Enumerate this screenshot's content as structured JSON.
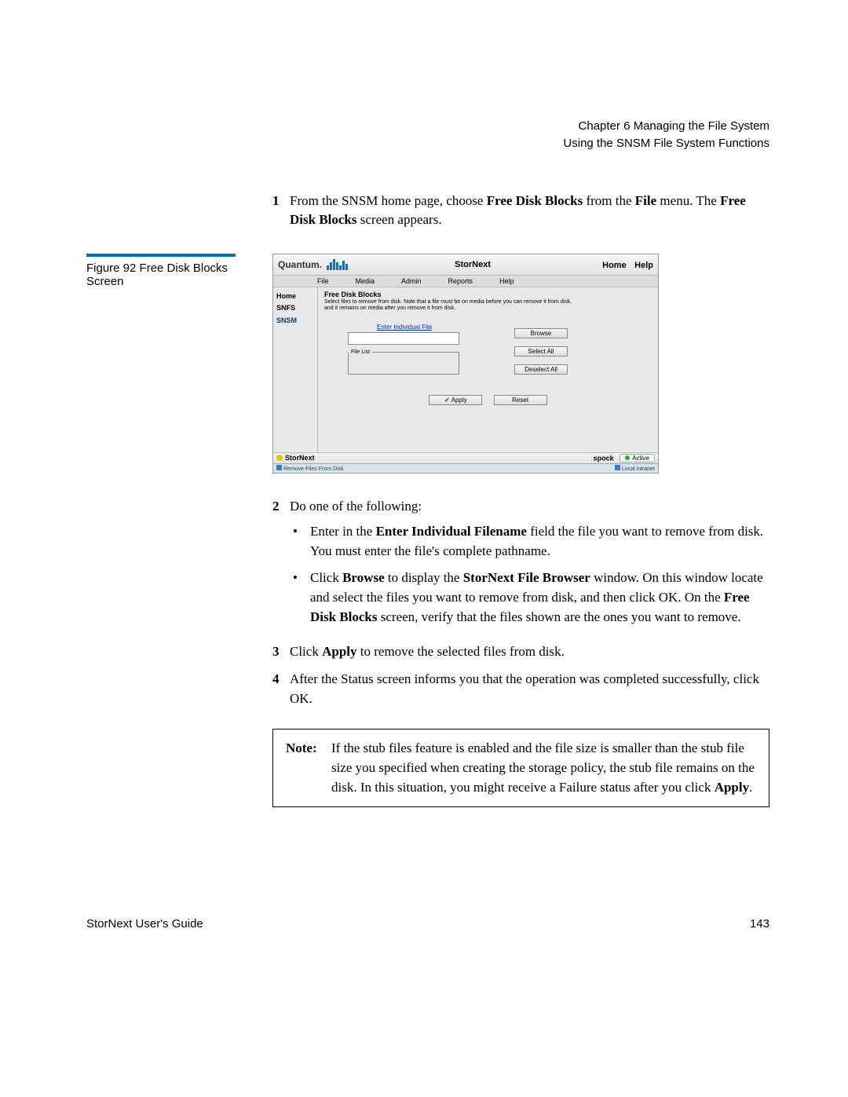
{
  "header": {
    "chapter": "Chapter 6  Managing the File System",
    "section": "Using the SNSM File System Functions"
  },
  "figure_caption": "Figure 92  Free Disk Blocks Screen",
  "step1": {
    "pre": "From the SNSM home page, choose ",
    "b1": "Free Disk Blocks",
    "mid1": " from the ",
    "b2": "File",
    "mid2": " menu. The ",
    "b3": "Free Disk Blocks",
    "post": " screen appears."
  },
  "screenshot": {
    "brand": "Quantum.",
    "app": "StorNext",
    "top_links": {
      "home": "Home",
      "help": "Help"
    },
    "menu": [
      "File",
      "Media",
      "Admin",
      "Reports",
      "Help"
    ],
    "sidebar": [
      "Home",
      "SNFS",
      "SNSM"
    ],
    "panel_title": "Free Disk Blocks",
    "panel_desc": "Select files to remove from disk. Note that a file must be on media before you can remove it from disk, and it remains on media after you remove it from disk.",
    "enter_link": "Enter Individual File",
    "file_list_legend": "File List",
    "buttons": {
      "browse": "Browse",
      "select_all": "Select All",
      "deselect_all": "Deselect All",
      "apply": "Apply",
      "reset": "Reset"
    },
    "foot_app": "StorNext",
    "foot_host": "spock",
    "foot_state": "Active",
    "status_left": "Remove Files From Disk",
    "status_right": "Local intranet"
  },
  "step2_intro": "Do one of the following:",
  "bullet1": {
    "pre": "Enter in the ",
    "b1": "Enter Individual Filename",
    "post": " field the file you want to remove from disk. You must enter the file's complete pathname."
  },
  "bullet2": {
    "pre": "Click ",
    "b1": "Browse",
    "mid1": " to display the ",
    "b2": "StorNext File Browser",
    "mid2": " window. On this window locate and select the files you want to remove from disk, and then click OK. On the ",
    "b3": "Free Disk Blocks",
    "post": " screen, verify that the files shown are the ones you want to remove."
  },
  "step3": {
    "pre": "Click ",
    "b1": "Apply",
    "post": " to remove the selected files from disk."
  },
  "step4": "After the Status screen informs you that the operation was completed successfully, click OK.",
  "note": {
    "label": "Note:",
    "pre": "If the stub files feature is enabled and the file size is smaller than the stub file size you specified when creating the storage policy, the stub file remains on the disk. In this situation, you might receive a Failure status after you click ",
    "b1": "Apply",
    "post": "."
  },
  "footer": {
    "guide": "StorNext User's Guide",
    "page": "143"
  }
}
